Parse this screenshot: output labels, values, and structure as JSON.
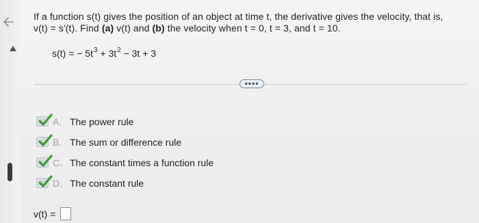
{
  "question": {
    "intro": "If a function s(t) gives the position of an object at time t, the derivative gives the velocity, that is,",
    "part_text_1": "v(t) = s′(t). Find ",
    "part_a_label": "(a)",
    "part_text_2": " v(t) and ",
    "part_b_label": "(b)",
    "part_text_3": " the velocity when t = 0, t = 3, and t = 10."
  },
  "equation": {
    "lhs": "s(t) = ",
    "term1": "− 5t",
    "exp1": "3",
    "term2": " + 3t",
    "exp2": "2",
    "term3": "   − 3t + 3"
  },
  "toolbar": {
    "more_label": "••••"
  },
  "options": [
    {
      "letter": "A.",
      "text": "The power rule"
    },
    {
      "letter": "B.",
      "text": "The sum or difference rule"
    },
    {
      "letter": "C.",
      "text": "The constant times a function rule"
    },
    {
      "letter": "D.",
      "text": "The constant rule"
    }
  ],
  "answer": {
    "label": "v(t) ="
  },
  "icons": {
    "back": "back-arrow-icon",
    "collapse": "collapse-up-icon",
    "check": "checkbox-check-icon"
  },
  "colors": {
    "check_green": "#3c9b2f",
    "checkbox_gray": "#b9c0c8",
    "more_button_blue": "#6e88a0"
  }
}
